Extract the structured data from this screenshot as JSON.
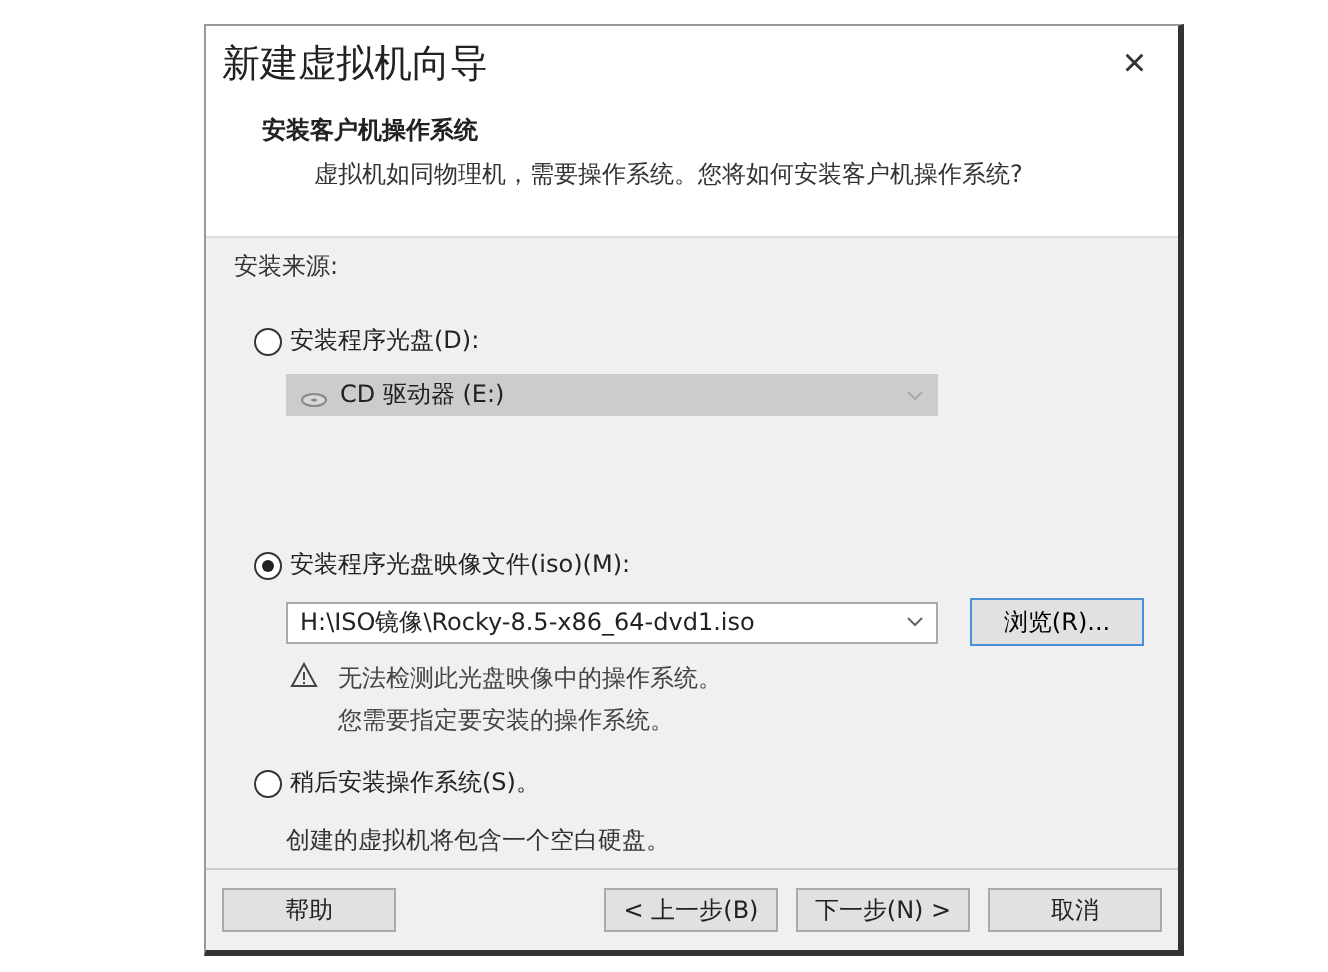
{
  "window": {
    "title": "新建虚拟机向导",
    "close": "×"
  },
  "header": {
    "heading": "安装客户机操作系统",
    "description": "虚拟机如同物理机，需要操作系统。您将如何安装客户机操作系统?"
  },
  "source_label": "安装来源:",
  "options": [
    {
      "kind": "disc",
      "label": "安装程序光盘(D):",
      "selected": false,
      "drive": {
        "value": "CD 驱动器 (E:)",
        "disabled": true
      }
    },
    {
      "kind": "iso",
      "label": "安装程序光盘映像文件(iso)(M):",
      "selected": true,
      "path": "H:\\ISO镜像\\Rocky-8.5-x86_64-dvd1.iso",
      "browse": "浏览(R)...",
      "warning": [
        "无法检测此光盘映像中的操作系统。",
        "您需要指定要安装的操作系统。"
      ]
    },
    {
      "kind": "later",
      "label": "稍后安装操作系统(S)。",
      "selected": false,
      "note": "创建的虚拟机将包含一个空白硬盘。"
    }
  ],
  "buttons": [
    {
      "label": "帮助",
      "kind": "help"
    },
    {
      "label": "< 上一步(B)",
      "kind": "nav"
    },
    {
      "label": "下一步(N) >",
      "kind": "nav"
    },
    {
      "label": "取消",
      "kind": "nav"
    }
  ]
}
